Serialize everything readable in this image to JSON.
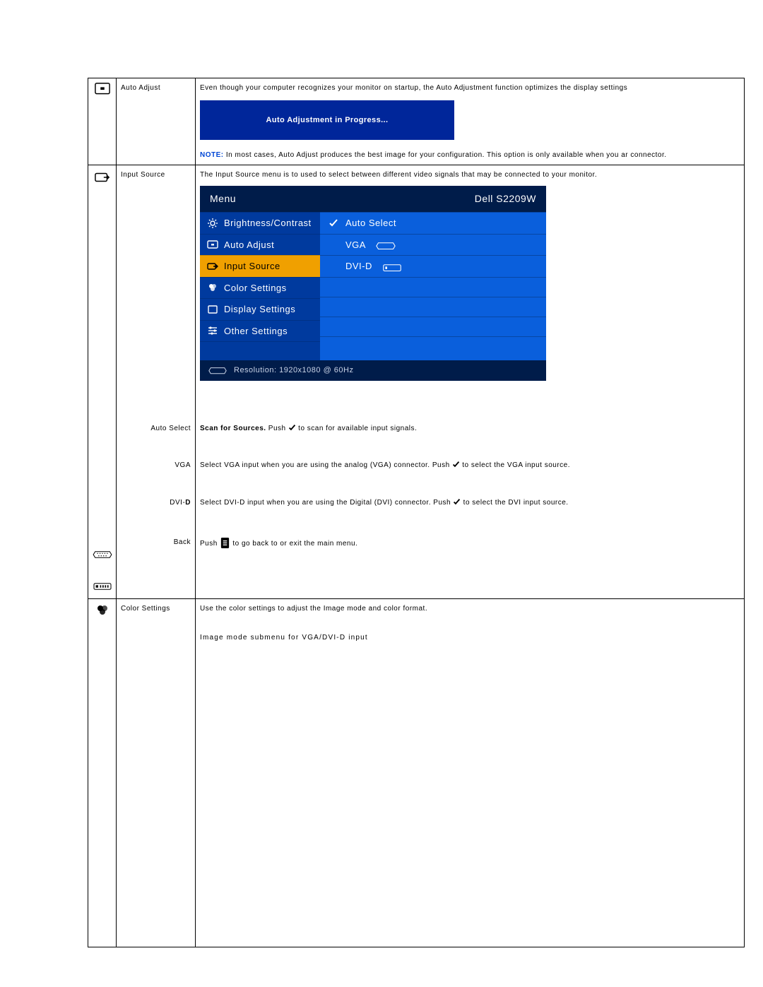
{
  "row1": {
    "label": "Auto Adjust",
    "desc": "Even though your computer recognizes your monitor on startup, the Auto Adjustment function optimizes the display settings",
    "banner": "Auto Adjustment in Progress...",
    "note_label": "NOTE:",
    "note_text": " In most cases, Auto Adjust produces the best image for your configuration. This option is only available when you ar connector."
  },
  "row2": {
    "label": "Input Source",
    "desc": "The Input Source menu is to used to select between different video signals that may be connected to your monitor.",
    "osd": {
      "menu_title": "Menu",
      "model": "Dell S2209W",
      "left": [
        "Brightness/Contrast",
        "Auto Adjust",
        "Input Source",
        "Color Settings",
        "Display Settings",
        "Other Settings"
      ],
      "right": {
        "auto_select": "Auto Select",
        "vga": "VGA",
        "dvi": "DVI-D"
      },
      "footer": "Resolution: 1920x1080 @ 60Hz"
    },
    "sub": {
      "auto_select": {
        "label": "Auto Select",
        "bold": "Scan for Sources.",
        "rest1": " Push ",
        "rest2": " to scan for available input signals."
      },
      "vga": {
        "label": "VGA",
        "t1": "Select VGA input when you are using the analog (VGA) connector. Push ",
        "t2": " to select the VGA input source."
      },
      "dvi": {
        "label_pre": "DVI-",
        "label_bold": "D",
        "t1": "Select DVI-D input when you are using the Digital (DVI) connector. Push ",
        "t2": " to select the DVI input source."
      },
      "back": {
        "label": "Back",
        "t1": "Push ",
        "t2": "  to go back to or exit the main menu."
      }
    }
  },
  "row3": {
    "label": "Color Settings",
    "desc": "Use the color settings to adjust the Image mode and color format.",
    "sub_desc": "Image mode submenu for VGA/DVI-D input"
  }
}
